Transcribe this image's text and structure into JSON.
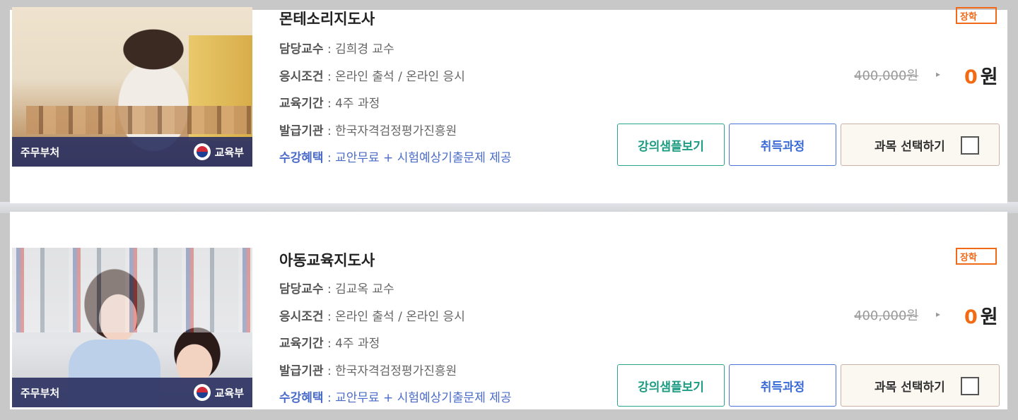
{
  "courses": [
    {
      "title": "몬테소리지도사",
      "badge": "장학",
      "thumb_left_label": "주무부처",
      "thumb_right_label": "교육부",
      "info": [
        {
          "label": "담당교수",
          "value": " : 김희경 교수"
        },
        {
          "label": "응시조건",
          "value": " : 온라인 출석 / 온라인 응시"
        },
        {
          "label": "교육기간",
          "value": " : 4주 과정"
        },
        {
          "label": "발급기관",
          "value": " : 한국자격검정평가진흥원"
        },
        {
          "label": "수강혜택",
          "value": " : 교안무료 + 시험예상기출문제 제공"
        }
      ],
      "original_price": "400,000원",
      "price_number": "0",
      "price_unit": "원",
      "btn_sample": "강의샘플보기",
      "btn_course": "취득과정",
      "btn_select": "과목 선택하기"
    },
    {
      "title": "아동교육지도사",
      "badge": "장학",
      "thumb_left_label": "주무부처",
      "thumb_right_label": "교육부",
      "info": [
        {
          "label": "담당교수",
          "value": " : 김교옥 교수"
        },
        {
          "label": "응시조건",
          "value": " : 온라인 출석 / 온라인 응시"
        },
        {
          "label": "교육기간",
          "value": " : 4주 과정"
        },
        {
          "label": "발급기관",
          "value": " : 한국자격검정평가진흥원"
        },
        {
          "label": "수강혜택",
          "value": " : 교안무료 + 시험예상기출문제 제공"
        }
      ],
      "original_price": "400,000원",
      "price_number": "0",
      "price_unit": "원",
      "btn_sample": "강의샘플보기",
      "btn_course": "취득과정",
      "btn_select": "과목 선택하기"
    }
  ],
  "colors": {
    "accent_orange": "#f36a12",
    "benefit_blue": "#4a6cc8",
    "sample_green": "#1c9c83",
    "course_blue": "#3a6ad6",
    "thumb_bar_navy": "#2c3262"
  }
}
